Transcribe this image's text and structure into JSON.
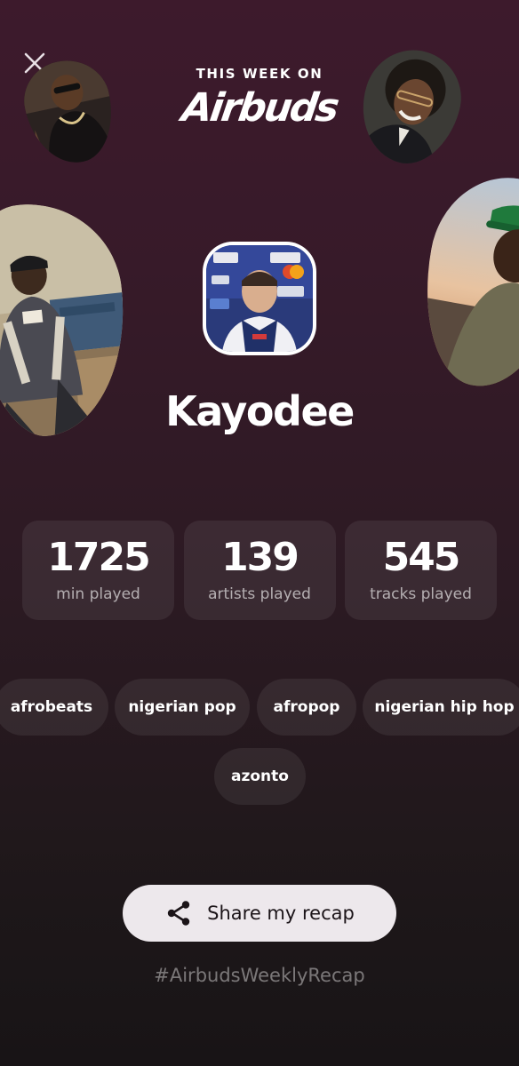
{
  "header": {
    "kicker": "THIS WEEK ON",
    "logo": "Airbuds"
  },
  "icons": {
    "close": "close-icon",
    "share": "share-icon"
  },
  "profile": {
    "username": "Kayodee"
  },
  "stats": [
    {
      "value": "1725",
      "label": "min played"
    },
    {
      "value": "139",
      "label": "artists played"
    },
    {
      "value": "545",
      "label": "tracks played"
    }
  ],
  "genres": [
    "afrobeats",
    "nigerian pop",
    "afropop",
    "nigerian hip hop",
    "azonto"
  ],
  "share": {
    "label": "Share my recap"
  },
  "hashtag": "#AirbudsWeeklyRecap",
  "colors": {
    "background_top": "#3d1a2c",
    "background_bottom": "#181416",
    "button_bg": "#ede8ec",
    "text_primary": "#ffffff"
  }
}
